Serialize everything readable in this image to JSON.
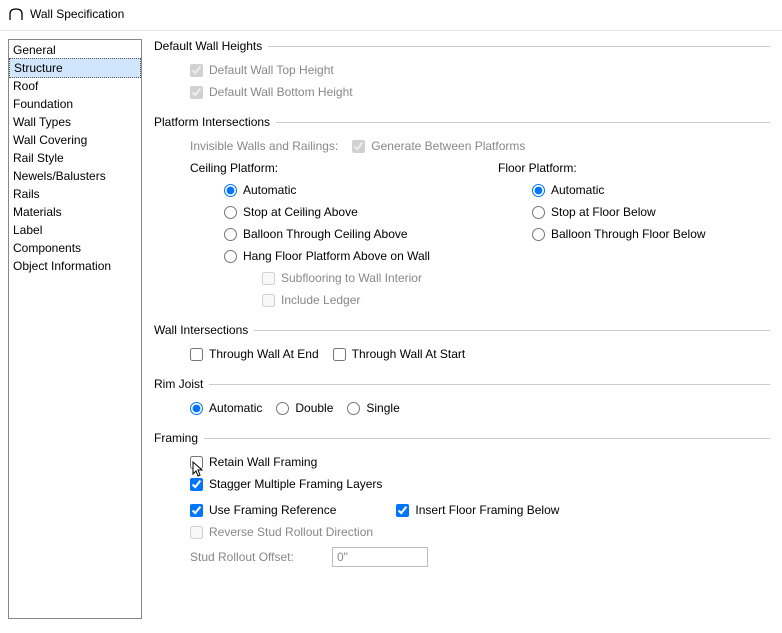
{
  "window": {
    "title": "Wall Specification"
  },
  "sidebar": {
    "items": [
      {
        "label": "General"
      },
      {
        "label": "Structure"
      },
      {
        "label": "Roof"
      },
      {
        "label": "Foundation"
      },
      {
        "label": "Wall Types"
      },
      {
        "label": "Wall Covering"
      },
      {
        "label": "Rail Style"
      },
      {
        "label": "Newels/Balusters"
      },
      {
        "label": "Rails"
      },
      {
        "label": "Materials"
      },
      {
        "label": "Label"
      },
      {
        "label": "Components"
      },
      {
        "label": "Object Information"
      }
    ],
    "selected_index": 1
  },
  "sections": {
    "default_wall_heights": {
      "title": "Default Wall Heights",
      "top": "Default Wall Top Height",
      "bottom": "Default Wall Bottom Height"
    },
    "platform_intersections": {
      "title": "Platform Intersections",
      "invisible_label": "Invisible Walls and Railings:",
      "generate": "Generate Between Platforms",
      "ceiling_title": "Ceiling Platform:",
      "ceiling_options": {
        "automatic": "Automatic",
        "stop": "Stop at Ceiling Above",
        "balloon": "Balloon Through Ceiling Above",
        "hang": "Hang Floor Platform Above on Wall",
        "subflooring": "Subflooring to Wall Interior",
        "ledger": "Include Ledger"
      },
      "floor_title": "Floor Platform:",
      "floor_options": {
        "automatic": "Automatic",
        "stop": "Stop at Floor Below",
        "balloon": "Balloon Through Floor Below"
      }
    },
    "wall_intersections": {
      "title": "Wall Intersections",
      "end": "Through Wall At End",
      "start": "Through Wall At Start"
    },
    "rim_joist": {
      "title": "Rim Joist",
      "automatic": "Automatic",
      "double": "Double",
      "single": "Single"
    },
    "framing": {
      "title": "Framing",
      "retain": "Retain Wall Framing",
      "stagger": "Stagger Multiple Framing Layers",
      "use_ref": "Use Framing Reference",
      "insert_below": "Insert Floor Framing Below",
      "reverse": "Reverse Stud Rollout Direction",
      "offset_label": "Stud Rollout Offset:",
      "offset_value": "0\""
    }
  }
}
